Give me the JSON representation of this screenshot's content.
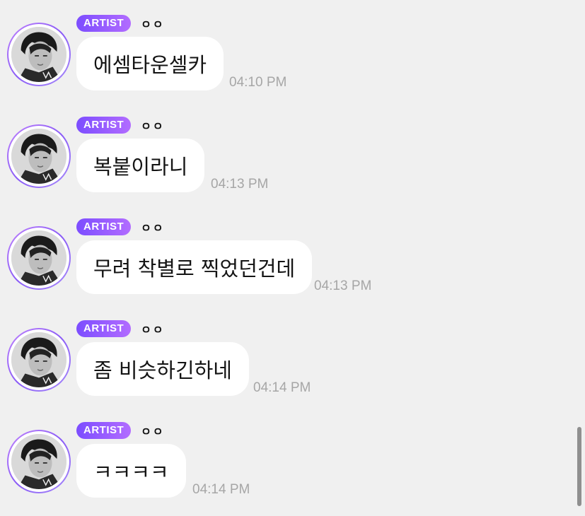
{
  "messages": [
    {
      "badge": "ARTIST",
      "nickname": "ㅇㅇ",
      "text": "에셈타운셀카",
      "time": "04:10 PM"
    },
    {
      "badge": "ARTIST",
      "nickname": "ㅇㅇ",
      "text": "복붙이라니",
      "time": "04:13 PM"
    },
    {
      "badge": "ARTIST",
      "nickname": "ㅇㅇ",
      "text": "무려 착별로 찍었던건데",
      "time": "04:13 PM"
    },
    {
      "badge": "ARTIST",
      "nickname": "ㅇㅇ",
      "text": "좀 비슷하긴하네",
      "time": "04:14 PM"
    },
    {
      "badge": "ARTIST",
      "nickname": "ㅇㅇ",
      "text": "ㅋㅋㅋㅋ",
      "time": "04:14 PM"
    }
  ],
  "icons": {
    "avatar": "artist-avatar-photo",
    "scrollbar": "scrollbar-thumb"
  },
  "colors": {
    "background": "#f0f0f0",
    "bubble": "#ffffff",
    "badge_start": "#7c4dff",
    "badge_end": "#b26cff",
    "avatar_ring": "#a66cf7",
    "timestamp": "#a6a6a6"
  }
}
